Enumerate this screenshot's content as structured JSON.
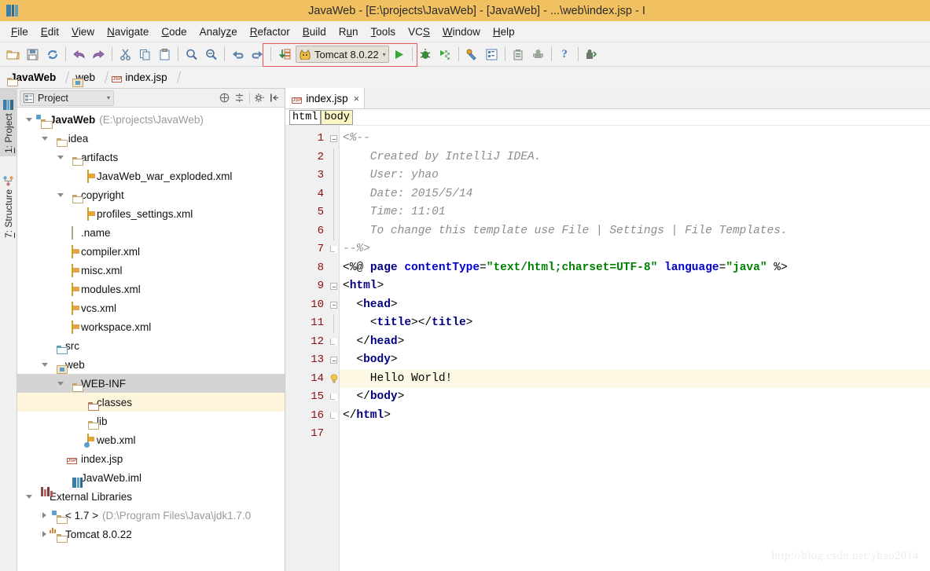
{
  "window": {
    "title": "JavaWeb - [E:\\projects\\JavaWeb] - [JavaWeb] - ...\\web\\index.jsp - I",
    "logo_icon": "intellij-idea-logo-icon"
  },
  "menubar": {
    "items": [
      {
        "label": "File",
        "mnemonic": "F"
      },
      {
        "label": "Edit",
        "mnemonic": "E"
      },
      {
        "label": "View",
        "mnemonic": "V"
      },
      {
        "label": "Navigate",
        "mnemonic": "N"
      },
      {
        "label": "Code",
        "mnemonic": "C"
      },
      {
        "label": "Analyze",
        "mnemonic": "z"
      },
      {
        "label": "Refactor",
        "mnemonic": "R"
      },
      {
        "label": "Build",
        "mnemonic": "B"
      },
      {
        "label": "Run",
        "mnemonic": "u"
      },
      {
        "label": "Tools",
        "mnemonic": "T"
      },
      {
        "label": "VCS",
        "mnemonic": "S"
      },
      {
        "label": "Window",
        "mnemonic": "W"
      },
      {
        "label": "Help",
        "mnemonic": "H"
      }
    ]
  },
  "toolbar": {
    "buttons": [
      {
        "name": "open-project-icon",
        "title": "Open"
      },
      {
        "name": "save-all-icon",
        "title": "Save All"
      },
      {
        "name": "synchronize-icon",
        "title": "Synchronize"
      },
      {
        "name": "back-icon",
        "title": "Back"
      },
      {
        "name": "forward-icon",
        "title": "Forward"
      },
      {
        "name": "cut-icon",
        "title": "Cut"
      },
      {
        "name": "copy-icon",
        "title": "Copy"
      },
      {
        "name": "paste-icon",
        "title": "Paste"
      },
      {
        "name": "find-icon",
        "title": "Find"
      },
      {
        "name": "replace-icon",
        "title": "Replace"
      },
      {
        "name": "undo-icon",
        "title": "Undo"
      },
      {
        "name": "redo-icon",
        "title": "Redo"
      },
      {
        "name": "compile-icon",
        "title": "Make Project"
      }
    ],
    "run_config": {
      "label": "Tomcat 8.0.22",
      "icon": "tomcat-cat-icon",
      "chevron": "▾"
    },
    "run_button": {
      "name": "run-button",
      "glyph": "▶",
      "color": "#35a635"
    },
    "right_buttons": [
      {
        "name": "debug-icon",
        "title": "Debug"
      },
      {
        "name": "run-with-coverage-icon",
        "title": "Run with Coverage"
      },
      {
        "name": "project-structure-icon",
        "title": "Project Structure"
      },
      {
        "name": "settings-icon",
        "title": "Settings"
      },
      {
        "name": "sdk-manager-icon",
        "title": "SDK Manager"
      },
      {
        "name": "avd-manager-icon",
        "title": "AVD Manager"
      },
      {
        "name": "help-icon",
        "title": "Help",
        "glyph": "?"
      },
      {
        "name": "android-tools-icon",
        "title": "Android Tools"
      }
    ],
    "annotation_box_color": "#e05a5a"
  },
  "navigation_breadcrumb": {
    "items": [
      {
        "label": "JavaWeb",
        "icon": "project-folder-icon",
        "bold": true
      },
      {
        "label": "web",
        "icon": "web-folder-icon",
        "bold": false
      },
      {
        "label": "index.jsp",
        "icon": "jsp-file-icon",
        "bold": false
      }
    ]
  },
  "left_rail": {
    "tabs": [
      {
        "label": "1: Project",
        "mnemonic": "1",
        "icon": "project-tool-icon",
        "active": true
      },
      {
        "label": "7: Structure",
        "mnemonic": "7",
        "icon": "structure-tool-icon",
        "active": false
      }
    ]
  },
  "project_panel": {
    "title": "Project",
    "title_icon": "project-view-icon",
    "chevron": "▾",
    "tools": [
      {
        "name": "collapse-all-icon",
        "title": "Collapse All"
      },
      {
        "name": "expand-all-icon",
        "title": "Expand All"
      },
      {
        "name": "settings-gear-icon",
        "title": "Settings"
      },
      {
        "name": "hide-panel-icon",
        "title": "Hide"
      }
    ],
    "tree": [
      {
        "depth": 0,
        "label": "JavaWeb",
        "suffix": "(E:\\projects\\JavaWeb)",
        "icon": "project-root-folder-icon",
        "twist": "down",
        "bold": true,
        "state": "normal"
      },
      {
        "depth": 1,
        "label": ".idea",
        "suffix": "",
        "icon": "folder-tan-icon",
        "twist": "down",
        "bold": false,
        "state": "normal"
      },
      {
        "depth": 2,
        "label": "artifacts",
        "suffix": "",
        "icon": "folder-tan-icon",
        "twist": "down",
        "bold": false,
        "state": "normal"
      },
      {
        "depth": 3,
        "label": "JavaWeb_war_exploded.xml",
        "suffix": "",
        "icon": "xml-file-icon",
        "twist": "none",
        "bold": false,
        "state": "normal"
      },
      {
        "depth": 2,
        "label": "copyright",
        "suffix": "",
        "icon": "folder-tan-icon",
        "twist": "down",
        "bold": false,
        "state": "normal"
      },
      {
        "depth": 3,
        "label": "profiles_settings.xml",
        "suffix": "",
        "icon": "xml-file-icon",
        "twist": "none",
        "bold": false,
        "state": "normal"
      },
      {
        "depth": 2,
        "label": ".name",
        "suffix": "",
        "icon": "text-file-icon",
        "twist": "none",
        "bold": false,
        "state": "normal"
      },
      {
        "depth": 2,
        "label": "compiler.xml",
        "suffix": "",
        "icon": "xml-file-icon",
        "twist": "none",
        "bold": false,
        "state": "normal"
      },
      {
        "depth": 2,
        "label": "misc.xml",
        "suffix": "",
        "icon": "xml-file-icon",
        "twist": "none",
        "bold": false,
        "state": "normal"
      },
      {
        "depth": 2,
        "label": "modules.xml",
        "suffix": "",
        "icon": "xml-file-icon",
        "twist": "none",
        "bold": false,
        "state": "normal"
      },
      {
        "depth": 2,
        "label": "vcs.xml",
        "suffix": "",
        "icon": "xml-file-icon",
        "twist": "none",
        "bold": false,
        "state": "normal"
      },
      {
        "depth": 2,
        "label": "workspace.xml",
        "suffix": "",
        "icon": "xml-file-icon",
        "twist": "none",
        "bold": false,
        "state": "normal"
      },
      {
        "depth": 1,
        "label": "src",
        "suffix": "",
        "icon": "folder-source-icon",
        "twist": "none",
        "bold": false,
        "state": "normal"
      },
      {
        "depth": 1,
        "label": "web",
        "suffix": "",
        "icon": "web-root-folder-icon",
        "twist": "down",
        "bold": false,
        "state": "normal"
      },
      {
        "depth": 2,
        "label": "WEB-INF",
        "suffix": "",
        "icon": "folder-tan-icon",
        "twist": "down",
        "bold": false,
        "state": "selected"
      },
      {
        "depth": 3,
        "label": "classes",
        "suffix": "",
        "icon": "folder-brown-icon",
        "twist": "none",
        "bold": false,
        "state": "highlighted"
      },
      {
        "depth": 3,
        "label": "lib",
        "suffix": "",
        "icon": "folder-tan-icon",
        "twist": "none",
        "bold": false,
        "state": "normal"
      },
      {
        "depth": 3,
        "label": "web.xml",
        "suffix": "",
        "icon": "web-xml-file-icon",
        "twist": "none",
        "bold": false,
        "state": "normal"
      },
      {
        "depth": 2,
        "label": "index.jsp",
        "suffix": "",
        "icon": "jsp-file-icon",
        "twist": "none",
        "bold": false,
        "state": "normal"
      },
      {
        "depth": 2,
        "label": "JavaWeb.iml",
        "suffix": "",
        "icon": "iml-file-icon",
        "twist": "none",
        "bold": false,
        "state": "normal"
      },
      {
        "depth": 0,
        "label": "External Libraries",
        "suffix": "",
        "icon": "libraries-icon",
        "twist": "down",
        "bold": false,
        "state": "normal"
      },
      {
        "depth": 1,
        "label": "< 1.7 >",
        "suffix": "(D:\\Program Files\\Java\\jdk1.7.0",
        "icon": "jdk-folder-icon",
        "twist": "right",
        "bold": false,
        "state": "normal"
      },
      {
        "depth": 1,
        "label": "Tomcat 8.0.22",
        "suffix": "",
        "icon": "tomcat-library-icon",
        "twist": "right",
        "bold": false,
        "state": "normal"
      }
    ]
  },
  "editor": {
    "tab": {
      "label": "index.jsp",
      "icon": "jsp-file-icon",
      "close": "×"
    },
    "breadcrumbs": [
      {
        "label": "html",
        "highlighted": false
      },
      {
        "label": "body",
        "highlighted": true
      }
    ],
    "line_numbers": [
      "1",
      "2",
      "3",
      "4",
      "5",
      "6",
      "7",
      "8",
      "9",
      "10",
      "11",
      "12",
      "13",
      "14",
      "15",
      "16",
      "17"
    ],
    "caret_line": 14,
    "gutter_bulb_line": 14,
    "lines": [
      {
        "num": 1,
        "segments": [
          {
            "t": "<%--",
            "c": "cmt"
          }
        ]
      },
      {
        "num": 2,
        "segments": [
          {
            "t": "    Created by IntelliJ IDEA.",
            "c": "cmt"
          }
        ]
      },
      {
        "num": 3,
        "segments": [
          {
            "t": "    User: yhao",
            "c": "cmt"
          }
        ]
      },
      {
        "num": 4,
        "segments": [
          {
            "t": "    Date: 2015/5/14",
            "c": "cmt"
          }
        ]
      },
      {
        "num": 5,
        "segments": [
          {
            "t": "    Time: 11:01",
            "c": "cmt"
          }
        ]
      },
      {
        "num": 6,
        "segments": [
          {
            "t": "    To change this template use File | Settings | File Templates.",
            "c": "cmt"
          }
        ]
      },
      {
        "num": 7,
        "segments": [
          {
            "t": "--%>",
            "c": "cmt"
          }
        ]
      },
      {
        "num": 8,
        "segments": [
          {
            "t": "<%@ ",
            "c": "jspd"
          },
          {
            "t": "page ",
            "c": "jspkw"
          },
          {
            "t": "contentType",
            "c": "attr"
          },
          {
            "t": "=",
            "c": "jspd"
          },
          {
            "t": "\"text/html;charset=UTF-8\"",
            "c": "attrval"
          },
          {
            "t": " ",
            "c": "jspd"
          },
          {
            "t": "language",
            "c": "attr"
          },
          {
            "t": "=",
            "c": "jspd"
          },
          {
            "t": "\"java\"",
            "c": "attrval"
          },
          {
            "t": " %>",
            "c": "jspd"
          }
        ]
      },
      {
        "num": 9,
        "segments": [
          {
            "t": "<",
            "c": "tagpunct"
          },
          {
            "t": "html",
            "c": "tagname"
          },
          {
            "t": ">",
            "c": "tagpunct"
          }
        ]
      },
      {
        "num": 10,
        "segments": [
          {
            "t": "  ",
            "c": "txt"
          },
          {
            "t": "<",
            "c": "tagpunct"
          },
          {
            "t": "head",
            "c": "tagname"
          },
          {
            "t": ">",
            "c": "tagpunct"
          }
        ]
      },
      {
        "num": 11,
        "segments": [
          {
            "t": "    ",
            "c": "txt"
          },
          {
            "t": "<",
            "c": "tagpunct"
          },
          {
            "t": "title",
            "c": "tagname"
          },
          {
            "t": "></",
            "c": "tagpunct"
          },
          {
            "t": "title",
            "c": "tagname"
          },
          {
            "t": ">",
            "c": "tagpunct"
          }
        ]
      },
      {
        "num": 12,
        "segments": [
          {
            "t": "  ",
            "c": "txt"
          },
          {
            "t": "</",
            "c": "tagpunct"
          },
          {
            "t": "head",
            "c": "tagname"
          },
          {
            "t": ">",
            "c": "tagpunct"
          }
        ]
      },
      {
        "num": 13,
        "segments": [
          {
            "t": "  ",
            "c": "txt"
          },
          {
            "t": "<",
            "c": "tagpunct"
          },
          {
            "t": "body",
            "c": "tagname"
          },
          {
            "t": ">",
            "c": "tagpunct"
          }
        ]
      },
      {
        "num": 14,
        "segments": [
          {
            "t": "    Hello World!",
            "c": "txt"
          }
        ]
      },
      {
        "num": 15,
        "segments": [
          {
            "t": "  ",
            "c": "txt"
          },
          {
            "t": "</",
            "c": "tagpunct"
          },
          {
            "t": "body",
            "c": "tagname"
          },
          {
            "t": ">",
            "c": "tagpunct"
          }
        ]
      },
      {
        "num": 16,
        "segments": [
          {
            "t": "</",
            "c": "tagpunct"
          },
          {
            "t": "html",
            "c": "tagname"
          },
          {
            "t": ">",
            "c": "tagpunct"
          }
        ]
      },
      {
        "num": 17,
        "segments": [
          {
            "t": "",
            "c": "txt"
          }
        ]
      }
    ]
  },
  "watermark": {
    "text": "http://blog.csdn.net/yhao2014"
  }
}
